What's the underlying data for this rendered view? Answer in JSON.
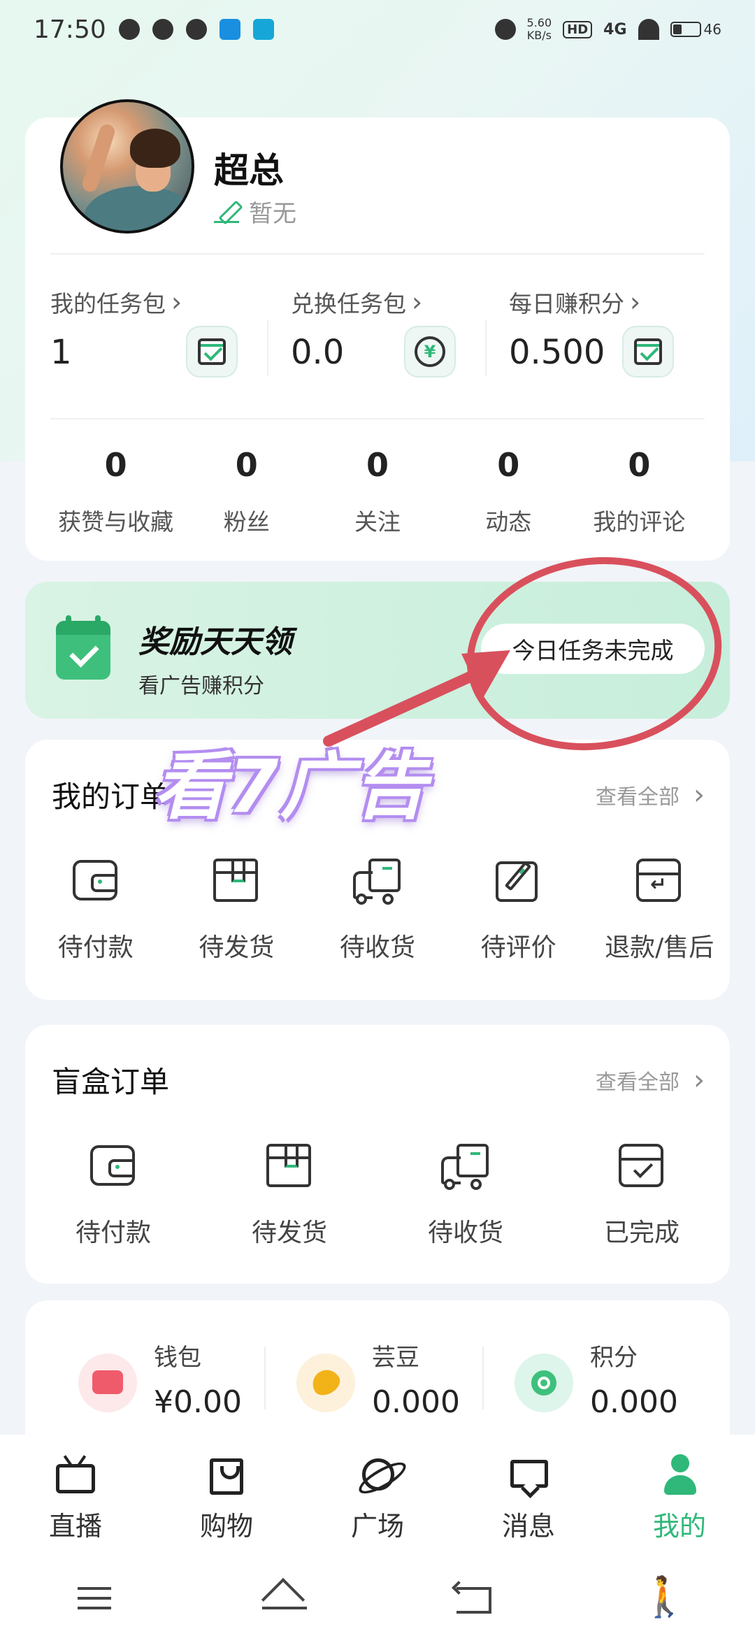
{
  "status_bar": {
    "time": "17:50",
    "speed_value": "5.60",
    "speed_unit": "KB/s",
    "hd": "HD",
    "network": "4G",
    "battery": "46"
  },
  "profile": {
    "name": "超总",
    "signature": "暂无"
  },
  "tasks": [
    {
      "label": "我的任务包",
      "value": "1",
      "icon": "calendar-check-icon"
    },
    {
      "label": "兑换任务包",
      "value": "0.0",
      "icon": "yuan-exchange-icon"
    },
    {
      "label": "每日赚积分",
      "value": "0.500",
      "icon": "calendar-check-icon"
    }
  ],
  "stats": [
    {
      "value": "0",
      "label": "获赞与收藏"
    },
    {
      "value": "0",
      "label": "粉丝"
    },
    {
      "value": "0",
      "label": "关注"
    },
    {
      "value": "0",
      "label": "动态"
    },
    {
      "value": "0",
      "label": "我的评论"
    }
  ],
  "reward": {
    "title": "奖励天天领",
    "subtitle": "看广告赚积分",
    "button": "今日任务未完成"
  },
  "annotation": {
    "text": "看7广告",
    "color": "#d9505d"
  },
  "my_orders": {
    "title": "我的订单",
    "view_all": "查看全部",
    "items": [
      {
        "label": "待付款",
        "icon": "wallet-icon"
      },
      {
        "label": "待发货",
        "icon": "box-icon"
      },
      {
        "label": "待收货",
        "icon": "truck-icon"
      },
      {
        "label": "待评价",
        "icon": "edit-icon"
      },
      {
        "label": "退款/售后",
        "icon": "return-box-icon"
      }
    ]
  },
  "blind_box_orders": {
    "title": "盲盒订单",
    "view_all": "查看全部",
    "items": [
      {
        "label": "待付款",
        "icon": "wallet-icon"
      },
      {
        "label": "待发货",
        "icon": "box-icon"
      },
      {
        "label": "待收货",
        "icon": "truck-icon"
      },
      {
        "label": "已完成",
        "icon": "done-box-icon"
      }
    ]
  },
  "assets": [
    {
      "name": "钱包",
      "value": "¥0.00",
      "icon": "wallet-red-icon",
      "color": "#f05b6c"
    },
    {
      "name": "芸豆",
      "value": "0.000",
      "icon": "bean-icon",
      "color": "#f2b318"
    },
    {
      "name": "积分",
      "value": "0.000",
      "icon": "points-icon",
      "color": "#3ec07c"
    }
  ],
  "bottom_nav": [
    {
      "label": "直播",
      "icon": "tv-icon",
      "active": false
    },
    {
      "label": "购物",
      "icon": "shopping-bag-icon",
      "active": false
    },
    {
      "label": "广场",
      "icon": "planet-icon",
      "active": false
    },
    {
      "label": "消息",
      "icon": "message-icon",
      "active": false
    },
    {
      "label": "我的",
      "icon": "user-icon",
      "active": true
    }
  ],
  "colors": {
    "accent": "#2fb879",
    "background": "#f1f4f8"
  }
}
